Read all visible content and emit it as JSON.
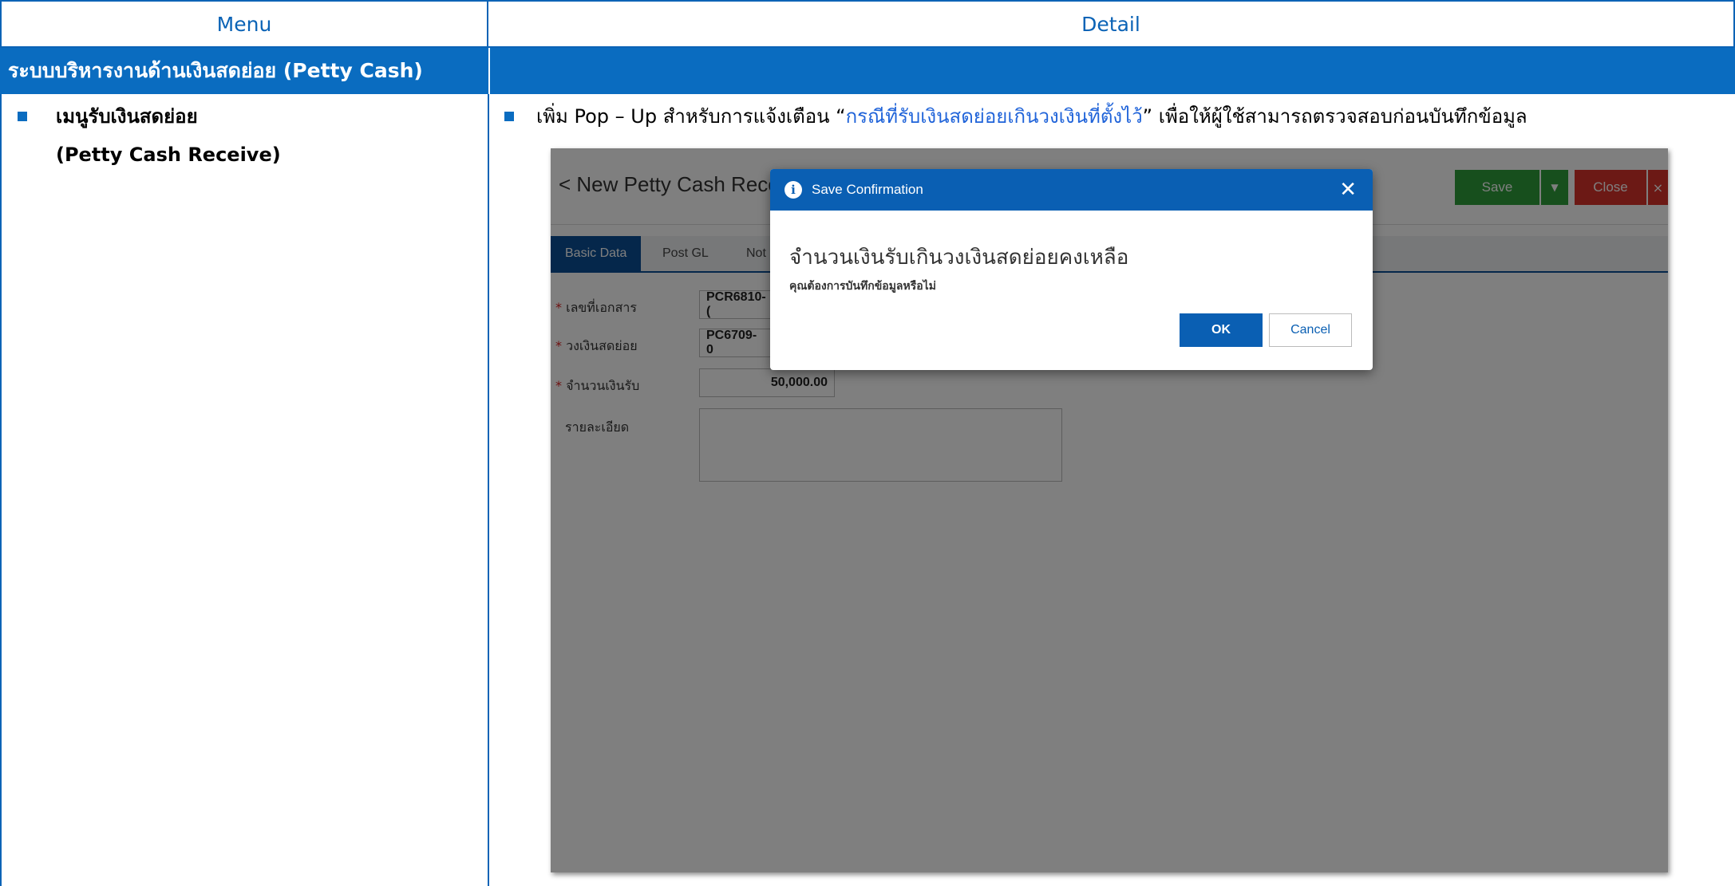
{
  "table": {
    "header_menu": "Menu",
    "header_detail": "Detail",
    "section_title": "ระบบบริหารงานด้านเงินสดย่อย (Petty Cash)"
  },
  "menu": {
    "title": "เมนูรับเงินสดย่อย",
    "subtitle": "(Petty Cash Receive)"
  },
  "detail": {
    "prefix": "เพิ่ม Pop – Up สำหรับการแจ้งเตือน “",
    "highlight": "กรณีที่รับเงินสดย่อยเกินวงเงินที่ตั้งไว้",
    "suffix": "” เพื่อให้ผู้ใช้สามารถตรวจสอบก่อนบันทึกข้อมูล"
  },
  "app": {
    "title": "< New Petty Cash Rece",
    "save_label": "Save",
    "close_label": "Close",
    "tabs": [
      "Basic Data",
      "Post GL",
      "Not"
    ],
    "fields": [
      {
        "label": "เลขที่เอกสาร",
        "value": "PCR6810-(",
        "required": true
      },
      {
        "label": "วงเงินสดย่อย",
        "value": "PC6709-0",
        "required": true
      },
      {
        "label": "จำนวนเงินรับ",
        "value": "50,000.00",
        "required": true
      },
      {
        "label": "รายละเอียด",
        "value": "",
        "required": false
      }
    ]
  },
  "dialog": {
    "title": "Save Confirmation",
    "message": "จำนวนเงินรับเกินวงเงินสดย่อยคงเหลือ",
    "sub_message": "คุณต้องการบันทึกข้อมูลหรือไม่",
    "ok_label": "OK",
    "cancel_label": "Cancel"
  },
  "colors": {
    "primary_blue": "#0a6cc0",
    "dialog_blue": "#0a5fb3",
    "save_green": "#2f9e3a",
    "close_red": "#d9332b",
    "highlight_blue": "#1f63d9"
  }
}
